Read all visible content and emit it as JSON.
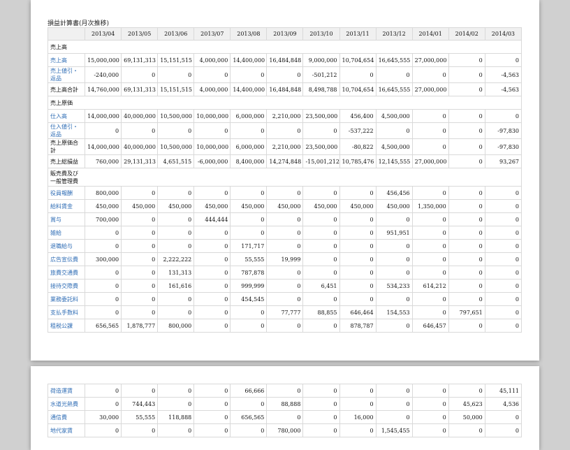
{
  "title": "損益計算書(月次推移)",
  "months": [
    "2013/04",
    "2013/05",
    "2013/06",
    "2013/07",
    "2013/08",
    "2013/09",
    "2013/10",
    "2013/11",
    "2013/12",
    "2014/01",
    "2014/02",
    "2014/03"
  ],
  "page1_rows": [
    {
      "kind": "section",
      "label": "売上高"
    },
    {
      "kind": "link",
      "label": "売上高",
      "values": [
        "15,000,000",
        "69,131,313",
        "15,151,515",
        "4,000,000",
        "14,400,000",
        "16,484,848",
        "9,000,000",
        "10,704,654",
        "16,645,555",
        "27,000,000",
        "0",
        "0"
      ]
    },
    {
      "kind": "link",
      "label": "売上値引・返品",
      "values": [
        "-240,000",
        "0",
        "0",
        "0",
        "0",
        "0",
        "-501,212",
        "0",
        "0",
        "0",
        "0",
        "-4,563"
      ]
    },
    {
      "kind": "total",
      "label": "売上高合計",
      "values": [
        "14,760,000",
        "69,131,313",
        "15,151,515",
        "4,000,000",
        "14,400,000",
        "16,484,848",
        "8,498,788",
        "10,704,654",
        "16,645,555",
        "27,000,000",
        "0",
        "-4,563"
      ]
    },
    {
      "kind": "section",
      "label": "売上原価"
    },
    {
      "kind": "link",
      "label": "仕入高",
      "values": [
        "14,000,000",
        "40,000,000",
        "10,500,000",
        "10,000,000",
        "6,000,000",
        "2,210,000",
        "23,500,000",
        "456,400",
        "4,500,000",
        "0",
        "0",
        "0"
      ]
    },
    {
      "kind": "link",
      "label": "仕入値引・返品",
      "values": [
        "0",
        "0",
        "0",
        "0",
        "0",
        "0",
        "0",
        "-537,222",
        "0",
        "0",
        "0",
        "-97,830"
      ]
    },
    {
      "kind": "total",
      "label": "売上原価合計",
      "values": [
        "14,000,000",
        "40,000,000",
        "10,500,000",
        "10,000,000",
        "6,000,000",
        "2,210,000",
        "23,500,000",
        "-80,822",
        "4,500,000",
        "0",
        "0",
        "-97,830"
      ]
    },
    {
      "kind": "total",
      "label": "売上総損益",
      "values": [
        "760,000",
        "29,131,313",
        "4,651,515",
        "-6,000,000",
        "8,400,000",
        "14,274,848",
        "-15,001,212",
        "10,785,476",
        "12,145,555",
        "27,000,000",
        "0",
        "93,267"
      ]
    },
    {
      "kind": "section",
      "label": "販売費及び一般管理費"
    },
    {
      "kind": "link",
      "label": "役員報酬",
      "values": [
        "800,000",
        "0",
        "0",
        "0",
        "0",
        "0",
        "0",
        "0",
        "456,456",
        "0",
        "0",
        "0"
      ]
    },
    {
      "kind": "link",
      "label": "給料賃金",
      "values": [
        "450,000",
        "450,000",
        "450,000",
        "450,000",
        "450,000",
        "450,000",
        "450,000",
        "450,000",
        "450,000",
        "1,350,000",
        "0",
        "0"
      ]
    },
    {
      "kind": "link",
      "label": "賞与",
      "values": [
        "700,000",
        "0",
        "0",
        "444,444",
        "0",
        "0",
        "0",
        "0",
        "0",
        "0",
        "0",
        "0"
      ]
    },
    {
      "kind": "link",
      "label": "雑給",
      "values": [
        "0",
        "0",
        "0",
        "0",
        "0",
        "0",
        "0",
        "0",
        "951,951",
        "0",
        "0",
        "0"
      ]
    },
    {
      "kind": "link",
      "label": "退職給与",
      "values": [
        "0",
        "0",
        "0",
        "0",
        "171,717",
        "0",
        "0",
        "0",
        "0",
        "0",
        "0",
        "0"
      ]
    },
    {
      "kind": "link",
      "label": "広告宣伝費",
      "values": [
        "300,000",
        "0",
        "2,222,222",
        "0",
        "55,555",
        "19,999",
        "0",
        "0",
        "0",
        "0",
        "0",
        "0"
      ]
    },
    {
      "kind": "link",
      "label": "旅費交通費",
      "values": [
        "0",
        "0",
        "131,313",
        "0",
        "787,878",
        "0",
        "0",
        "0",
        "0",
        "0",
        "0",
        "0"
      ]
    },
    {
      "kind": "link",
      "label": "接待交際費",
      "values": [
        "0",
        "0",
        "161,616",
        "0",
        "999,999",
        "0",
        "6,451",
        "0",
        "534,233",
        "614,212",
        "0",
        "0"
      ]
    },
    {
      "kind": "link",
      "label": "業務委託料",
      "values": [
        "0",
        "0",
        "0",
        "0",
        "454,545",
        "0",
        "0",
        "0",
        "0",
        "0",
        "0",
        "0"
      ]
    },
    {
      "kind": "link",
      "label": "支払手数料",
      "values": [
        "0",
        "0",
        "0",
        "0",
        "0",
        "77,777",
        "88,855",
        "646,464",
        "154,553",
        "0",
        "797,651",
        "0"
      ]
    },
    {
      "kind": "link",
      "label": "租税公課",
      "values": [
        "656,565",
        "1,878,777",
        "800,000",
        "0",
        "0",
        "0",
        "0",
        "878,787",
        "0",
        "646,457",
        "0",
        "0"
      ]
    }
  ],
  "page2_rows": [
    {
      "kind": "link",
      "label": "荷造運賃",
      "values": [
        "0",
        "0",
        "0",
        "0",
        "66,666",
        "0",
        "0",
        "0",
        "0",
        "0",
        "0",
        "45,111"
      ]
    },
    {
      "kind": "link",
      "label": "水道光熱費",
      "values": [
        "0",
        "744,443",
        "0",
        "0",
        "0",
        "88,888",
        "0",
        "0",
        "0",
        "0",
        "45,623",
        "4,536"
      ]
    },
    {
      "kind": "link",
      "label": "通信費",
      "values": [
        "30,000",
        "55,555",
        "118,888",
        "0",
        "656,565",
        "0",
        "0",
        "16,000",
        "0",
        "0",
        "50,000",
        "0"
      ]
    },
    {
      "kind": "link",
      "label": "地代家賃",
      "values": [
        "0",
        "0",
        "0",
        "0",
        "0",
        "780,000",
        "0",
        "0",
        "1,545,455",
        "0",
        "0",
        "0"
      ]
    }
  ]
}
